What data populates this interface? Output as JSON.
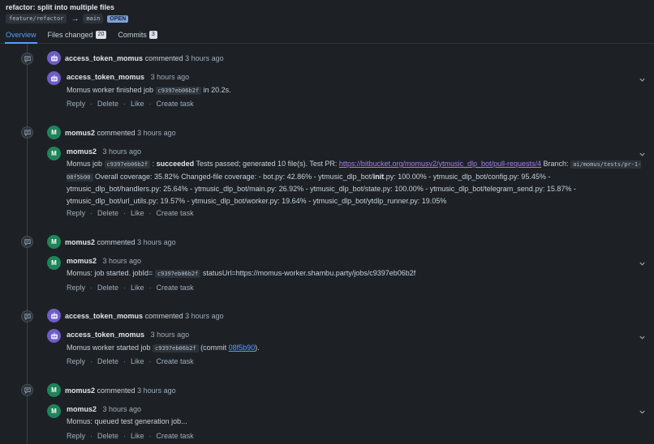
{
  "pr": {
    "title": "refactor: split into multiple files",
    "source_branch": "feature/refactor",
    "arrow": "→",
    "target_branch": "main",
    "state": "OPEN"
  },
  "tabs": [
    {
      "label": "Overview"
    },
    {
      "label": "Files changed",
      "count": "20"
    },
    {
      "label": "Commits",
      "count": "3"
    }
  ],
  "actions": {
    "reply": "Reply",
    "delete": "Delete",
    "like": "Like",
    "task": "Create task",
    "sep": "·"
  },
  "timeline": [
    {
      "author": "access_token_momus",
      "verb": "commented",
      "time": "3 hours ago",
      "body": {
        "t1": "Momus worker finished job ",
        "code": "c9397eb06b2f",
        "t2": " in 20.2s."
      }
    },
    {
      "author": "momus2",
      "initial": "M",
      "verb": "commented",
      "time": "3 hours ago",
      "body": {
        "t1": "Momus job ",
        "code1": "c9397eb06b2f",
        "t2": " : ",
        "bold": "succeeded",
        "t3": " Tests passed; generated 10 file(s). Test PR: ",
        "link": "https://bitbucket.org/momusv2/ytmusic_dlp_bot/pull-requests/4",
        "t4": " Branch: ",
        "code2": "ai/momus/tests/pr-1-08f5b90",
        "t5": " Overall coverage: 35.82% Changed-file coverage: - bot.py: 42.86% - ytmusic_dlp_bot/",
        "bold2": "init",
        "t6": ".py: 100.00% - ytmusic_dlp_bot/config.py: 95.45% - ytmusic_dlp_bot/handlers.py: 25.64% - ytmusic_dlp_bot/main.py: 26.92% - ytmusic_dlp_bot/state.py: 100.00% - ytmusic_dlp_bot/telegram_send.py: 15.87% - ytmusic_dlp_bot/url_utils.py: 19.57% - ytmusic_dlp_bot/worker.py: 19.64% - ytmusic_dlp_bot/ytdlp_runner.py: 19.05%"
      }
    },
    {
      "author": "momus2",
      "initial": "M",
      "verb": "commented",
      "time": "3 hours ago",
      "body": {
        "t1": "Momus: job started. jobId= ",
        "code": "c9397eb06b2f",
        "t2": " statusUrl=https://momus-worker.shambu.party/jobs/c9397eb06b2f"
      }
    },
    {
      "author": "access_token_momus",
      "verb": "commented",
      "time": "3 hours ago",
      "body": {
        "t1": "Momus worker started job ",
        "code": "c9397eb06b2f",
        "t2": " (commit ",
        "link": "08f5b90",
        "t3": ")."
      }
    },
    {
      "author": "momus2",
      "initial": "M",
      "verb": "commented",
      "time": "3 hours ago",
      "body": {
        "t1": "Momus: queued test generation job..."
      }
    }
  ],
  "colors": {
    "background": "#1d2125",
    "accent": "#579dff",
    "link_visited": "#a97ee6",
    "avatar_green": "#1f845a",
    "avatar_purple": "#6e5dc6"
  },
  "icons": [
    "comment-activity-icon",
    "robot-avatar-icon",
    "chevron-down-icon",
    "arrow-right-icon"
  ]
}
